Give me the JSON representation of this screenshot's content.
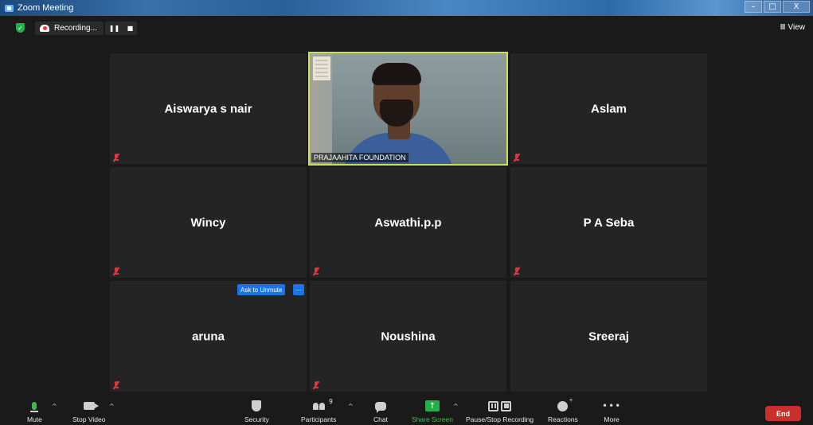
{
  "window": {
    "title": "Zoom Meeting",
    "controls": {
      "minimize": "–",
      "maximize": "□",
      "close": "X"
    }
  },
  "topbar": {
    "recording_label": "Recording...",
    "rec_pause": "❚❚",
    "rec_stop": "■",
    "view_icon": "Ⅲ",
    "view_label": "View"
  },
  "participants": [
    {
      "name": "Aiswarya s nair",
      "muted": true
    },
    {
      "name": "PRAJAAHITA FOUNDATION",
      "video": true
    },
    {
      "name": "Aslam",
      "muted": true
    },
    {
      "name": "Wincy",
      "muted": true
    },
    {
      "name": "Aswathi.p.p",
      "muted": true
    },
    {
      "name": "P A Seba",
      "muted": true
    },
    {
      "name": "aruna",
      "muted": true
    },
    {
      "name": "Noushina",
      "muted": true
    },
    {
      "name": "Sreeraj",
      "muted": false
    }
  ],
  "hover_actions": {
    "ask_to_unmute": "Ask to Unmute",
    "more": "···"
  },
  "toolbar": {
    "mute_label": "Mute",
    "stop_video_label": "Stop Video",
    "security_label": "Security",
    "participants_label": "Participants",
    "participants_count": "9",
    "chat_label": "Chat",
    "share_screen_label": "Share Screen",
    "share_icon": "↑",
    "pause_stop_recording_label": "Pause/Stop Recording",
    "reactions_label": "Reactions",
    "more_label": "More",
    "more_icon": "•••",
    "caret": "^",
    "end_label": "End"
  },
  "colors": {
    "background": "#1a1a1a",
    "tile": "#242424",
    "active_speaker_border": "#c7e15b",
    "accent_green": "#3cbf4a",
    "muted_red": "#e0383e",
    "end_red": "#c9302c",
    "action_blue": "#1a73e8"
  }
}
